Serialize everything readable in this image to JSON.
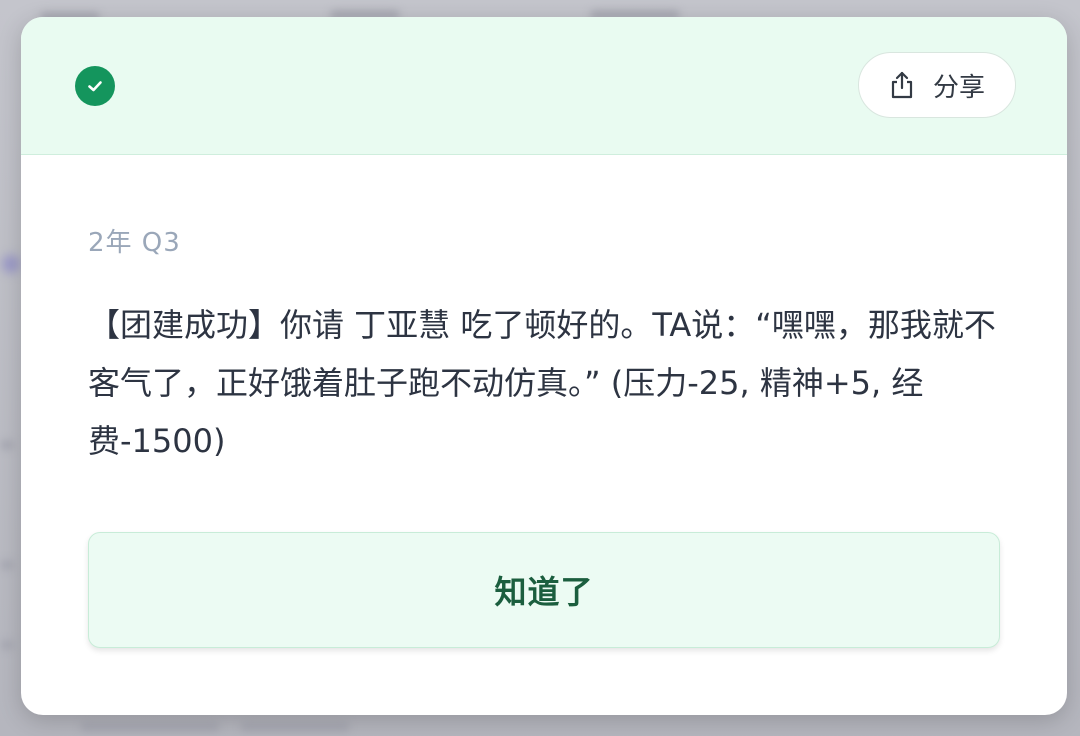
{
  "modal": {
    "header": {
      "status_icon": "check-circle-icon",
      "status_color": "#14955d",
      "share_icon": "share-upload-icon",
      "share_label": "分享"
    },
    "date_label": "2年  Q3",
    "event_text": "【团建成功】你请 丁亚慧 吃了顿好的。TA说：“嘿嘿，那我就不客气了，正好饿着肚子跑不动仿真。” (压力-25, 精神+5, 经费-1500)",
    "confirm_label": "知道了"
  },
  "colors": {
    "header_bg": "#e9fbf1",
    "accent": "#14955d",
    "button_bg": "#ecfbf3",
    "button_text": "#1b5e3e",
    "body_text": "#2d3442",
    "muted_text": "#9aa7b9"
  }
}
